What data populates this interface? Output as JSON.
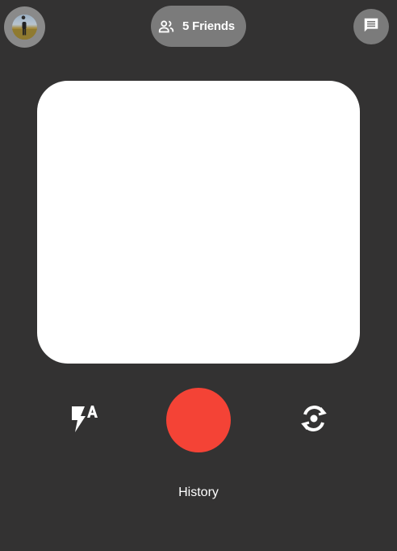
{
  "header": {
    "avatar_icon": "user-avatar",
    "friends_icon": "people-icon",
    "friends_label": "5 Friends",
    "chat_icon": "message-icon"
  },
  "camera": {
    "flash_icon": "flash-auto-icon",
    "shutter_color": "#f44336",
    "flip_icon": "switch-camera-icon"
  },
  "footer": {
    "history_label": "History"
  },
  "colors": {
    "background": "#333232",
    "pill": "#7b7b7b",
    "viewfinder": "#ffffff",
    "shutter": "#f44336"
  }
}
